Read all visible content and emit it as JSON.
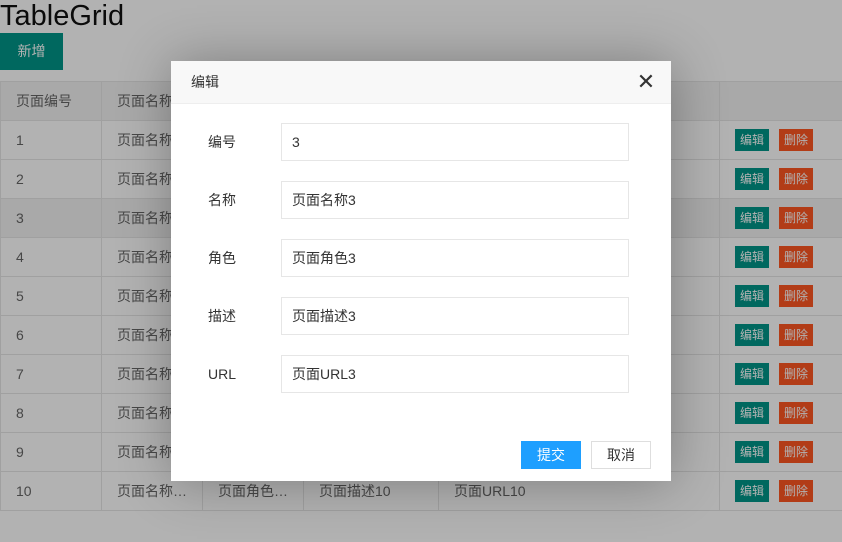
{
  "page": {
    "title": "TableGrid",
    "add_label": "新增"
  },
  "table": {
    "headers": [
      "页面编号",
      "页面名称",
      "",
      "",
      "",
      ""
    ],
    "rows": [
      {
        "id": "1",
        "name": "页面名称",
        "role": "",
        "desc": "",
        "url": ""
      },
      {
        "id": "2",
        "name": "页面名称",
        "role": "",
        "desc": "",
        "url": ""
      },
      {
        "id": "3",
        "name": "页面名称",
        "role": "",
        "desc": "",
        "url": ""
      },
      {
        "id": "4",
        "name": "页面名称",
        "role": "",
        "desc": "",
        "url": ""
      },
      {
        "id": "5",
        "name": "页面名称",
        "role": "",
        "desc": "",
        "url": ""
      },
      {
        "id": "6",
        "name": "页面名称",
        "role": "",
        "desc": "",
        "url": ""
      },
      {
        "id": "7",
        "name": "页面名称",
        "role": "",
        "desc": "",
        "url": ""
      },
      {
        "id": "8",
        "name": "页面名称",
        "role": "",
        "desc": "",
        "url": ""
      },
      {
        "id": "9",
        "name": "页面名称",
        "role": "",
        "desc": "",
        "url": ""
      },
      {
        "id": "10",
        "name": "页面名称…",
        "role": "页面角色…",
        "desc": "页面描述10",
        "url": "页面URL10"
      }
    ],
    "edit_label": "编辑",
    "delete_label": "删除"
  },
  "dialog": {
    "title": "编辑",
    "close_icon": "close-icon",
    "fields": [
      {
        "label": "编号",
        "value": "3"
      },
      {
        "label": "名称",
        "value": "页面名称3"
      },
      {
        "label": "角色",
        "value": "页面角色3"
      },
      {
        "label": "描述",
        "value": "页面描述3"
      },
      {
        "label": "URL",
        "value": "页面URL3"
      }
    ],
    "submit_label": "提交",
    "cancel_label": "取消"
  },
  "colors": {
    "primary": "#009688",
    "danger": "#FF5722",
    "submit": "#1E9FFF"
  }
}
